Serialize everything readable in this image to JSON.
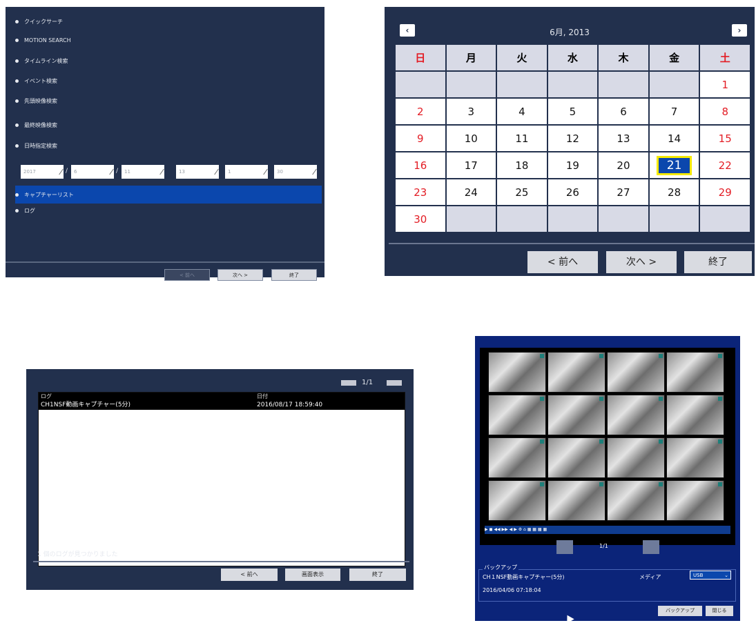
{
  "search_menu": {
    "items": [
      "クイックサーチ",
      "MOTION SEARCH",
      "タイムライン検索",
      "イベント検索",
      "先頭映像検索",
      "最終映像検索",
      "日時指定検索",
      "キャプチャーリスト",
      "ログ"
    ],
    "date_fields": [
      "2017",
      "6",
      "11",
      "13",
      "1",
      "30"
    ],
    "buttons": {
      "prev": "< 前へ",
      "next": "次へ >",
      "end": "終了"
    }
  },
  "calendar": {
    "month_label": "6月, 2013",
    "weekdays": [
      "日",
      "月",
      "火",
      "水",
      "木",
      "金",
      "土"
    ],
    "weeks": [
      [
        "",
        "",
        "",
        "",
        "",
        "",
        "1"
      ],
      [
        "2",
        "3",
        "4",
        "5",
        "6",
        "7",
        "8"
      ],
      [
        "9",
        "10",
        "11",
        "12",
        "13",
        "14",
        "15"
      ],
      [
        "16",
        "17",
        "18",
        "19",
        "20",
        "21",
        "22"
      ],
      [
        "23",
        "24",
        "25",
        "26",
        "27",
        "28",
        "29"
      ],
      [
        "30",
        "",
        "",
        "",
        "",
        "",
        ""
      ]
    ],
    "today": "21",
    "buttons": {
      "prev": "< 前へ",
      "next": "次へ >",
      "end": "終了"
    }
  },
  "log_list": {
    "page": "1/1",
    "columns": [
      "ログ",
      "日付"
    ],
    "rows": [
      {
        "log": "CH1NSF動画キャプチャー(5分)",
        "date": "2016/08/17 18:59:40"
      }
    ],
    "status": "1 個のログが見つかりました",
    "buttons": {
      "prev": "< 前へ",
      "view": "画面表示",
      "end": "終了"
    }
  },
  "backup": {
    "page": "1/1",
    "section_label": "バックアップ",
    "item": "CH１NSF動画キャプチャー(5分)",
    "datetime": "2016/04/06 07:18:04",
    "media_label": "メディア",
    "media_value": "USB",
    "buttons": {
      "backup": "バックアップ",
      "close": "閉じる"
    }
  },
  "colors": {
    "panel_bg": "#22304d",
    "selected": "#0b47ad",
    "sunday_red": "#e31c24",
    "today_border": "#f5ea00"
  }
}
